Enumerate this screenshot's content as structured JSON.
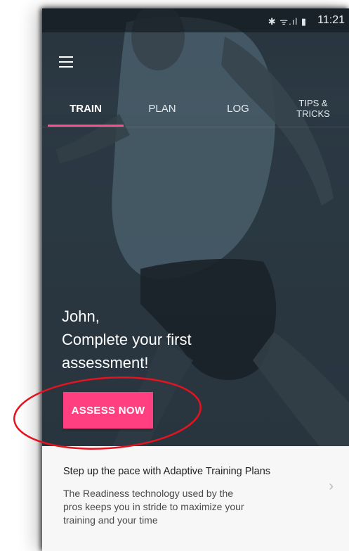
{
  "status_bar": {
    "icons": [
      "bluetooth-icon",
      "wifi-icon",
      "signal-icon",
      "battery-icon"
    ],
    "icons_text": "✱ ᯤ.ıl ▮",
    "time": "11:21"
  },
  "tabs": [
    {
      "label": "TRAIN",
      "active": true
    },
    {
      "label": "PLAN",
      "active": false
    },
    {
      "label": "LOG",
      "active": false
    },
    {
      "label_line1": "TIPS &",
      "label_line2": "TRICKS",
      "active": false
    }
  ],
  "hero": {
    "greeting": "John,",
    "line2": "Complete your first",
    "line3": "assessment!",
    "button_label": "ASSESS NOW"
  },
  "card": {
    "title": "Step up the pace with Adaptive Training Plans",
    "body_line1": "The Readiness technology used by the",
    "body_line2": "pros keeps you in stride to maximize your",
    "body_line3": "training and your time",
    "chevron": "›"
  },
  "colors": {
    "accent": "#ff3f7f",
    "tab_underline": "#ff4f86",
    "annotation": "#e3141f"
  }
}
